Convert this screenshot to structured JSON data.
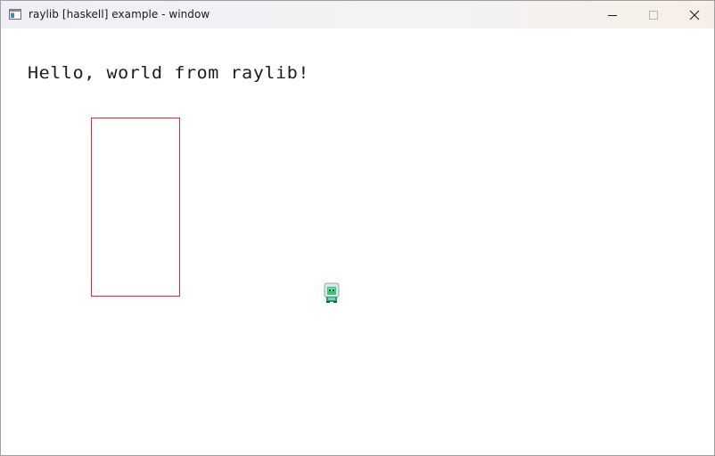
{
  "window": {
    "title": "raylib [haskell] example - window",
    "app_icon": "window-app-icon",
    "controls": {
      "minimize_icon": "minimize-icon",
      "maximize_icon": "maximize-icon",
      "close_icon": "close-icon"
    }
  },
  "canvas": {
    "text": "Hello, world from raylib!",
    "text_color": "#1b1b1b",
    "rectangle_outline_color": "#e6293a",
    "background_color": "#ffffff",
    "sprite_icon": "character-sprite-icon"
  }
}
